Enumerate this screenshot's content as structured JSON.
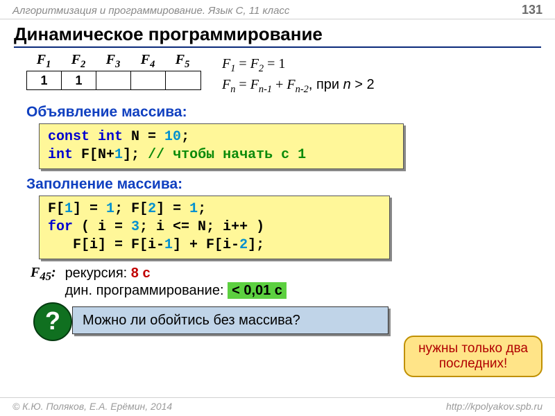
{
  "header": {
    "course": "Алгоритмизация и программирование. Язык С, 11 класс",
    "page_number": "131"
  },
  "title": "Динамическое программирование",
  "fib": {
    "labels": [
      "F₁",
      "F₂",
      "F₃",
      "F₄",
      "F₅"
    ],
    "cells": [
      "1",
      "1",
      "",
      "",
      ""
    ],
    "formula_line1": "F₁ = F₂ = 1",
    "formula_line2a": "Fₙ = Fₙ₋₁ + Fₙ₋₂",
    "formula_line2b": ", при n > 2"
  },
  "section1": "Объявление массива:",
  "code1": {
    "l1a": "const int",
    "l1b": " N = ",
    "l1c": "10",
    "l1d": ";",
    "l2a": "int",
    "l2b": " F[N+",
    "l2c": "1",
    "l2d": "]; ",
    "l2e": "// чтобы начать с 1"
  },
  "section2": "Заполнение массива:",
  "code2": {
    "l1a": "F[",
    "l1b": "1",
    "l1c": "] = ",
    "l1d": "1",
    "l1e": "; F[",
    "l1f": "2",
    "l1g": "] = ",
    "l1h": "1",
    "l1i": ";",
    "l2a": "for",
    "l2b": " ( i = ",
    "l2c": "3",
    "l2d": "; i <= N; i++ )",
    "l3": "   F[i] = F[i-",
    "l3b": "1",
    "l3c": "] + F[i-",
    "l3d": "2",
    "l3e": "];"
  },
  "timing": {
    "label": "F₄₅:",
    "line1a": "рекурсия: ",
    "line1b": "8 с",
    "line2a": "дин. программирование: ",
    "line2b": "< 0,01 с"
  },
  "question": "Можно ли обойтись без массива?",
  "question_mark": "?",
  "callout": "нужны только два последних!",
  "footer": {
    "copyright": "© К.Ю. Поляков, Е.А. Ерёмин, 2014",
    "url": "http://kpolyakov.spb.ru"
  }
}
